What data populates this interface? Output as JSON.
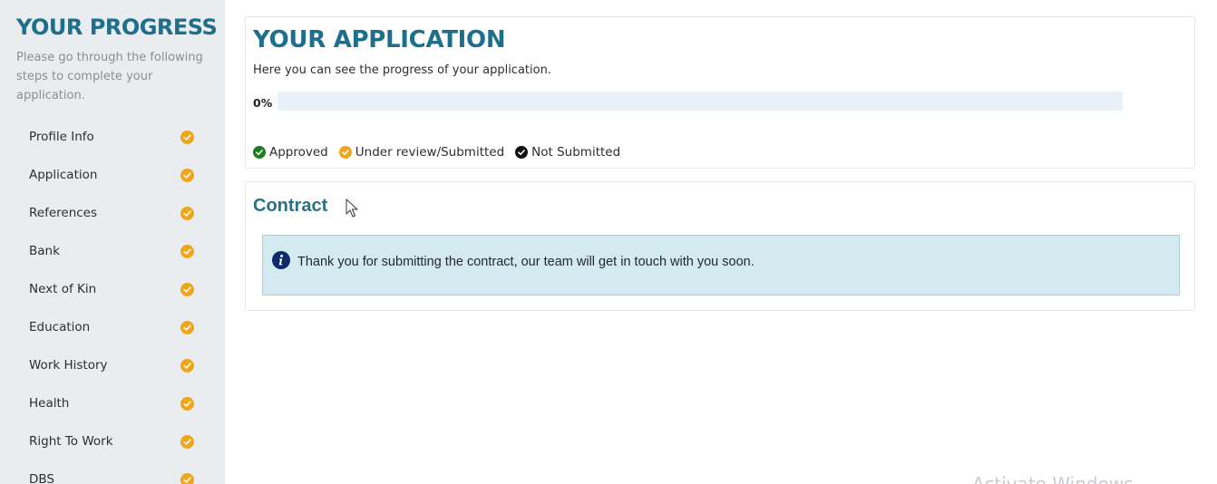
{
  "sidebar": {
    "title": "YOUR PROGRESS",
    "description": "Please go through the following steps to complete your application.",
    "steps": [
      {
        "label": "Profile Info",
        "status": "under-review"
      },
      {
        "label": "Application",
        "status": "under-review"
      },
      {
        "label": "References",
        "status": "under-review"
      },
      {
        "label": "Bank",
        "status": "under-review"
      },
      {
        "label": "Next of Kin",
        "status": "under-review"
      },
      {
        "label": "Education",
        "status": "under-review"
      },
      {
        "label": "Work History",
        "status": "under-review"
      },
      {
        "label": "Health",
        "status": "under-review"
      },
      {
        "label": "Right To Work",
        "status": "under-review"
      },
      {
        "label": "DBS",
        "status": "under-review"
      }
    ]
  },
  "application": {
    "title": "YOUR APPLICATION",
    "subtitle": "Here you can see the progress of your application.",
    "progress": {
      "label": "0%",
      "value": 0
    },
    "legend": [
      {
        "label": "Approved",
        "color": "#1e7d22"
      },
      {
        "label": "Under review/Submitted",
        "color": "#f0a51a"
      },
      {
        "label": "Not Submitted",
        "color": "#111111"
      }
    ]
  },
  "contract": {
    "title": "Contract",
    "info_icon": "info-circle-icon",
    "message": "Thank you for submitting the contract, our team will get in touch with you soon."
  },
  "watermark": "Activate Windows",
  "colors": {
    "accent": "#1d6f8c",
    "pending": "#f0a51a",
    "approved": "#1e7d22",
    "info_bg": "#d2eaf0"
  }
}
